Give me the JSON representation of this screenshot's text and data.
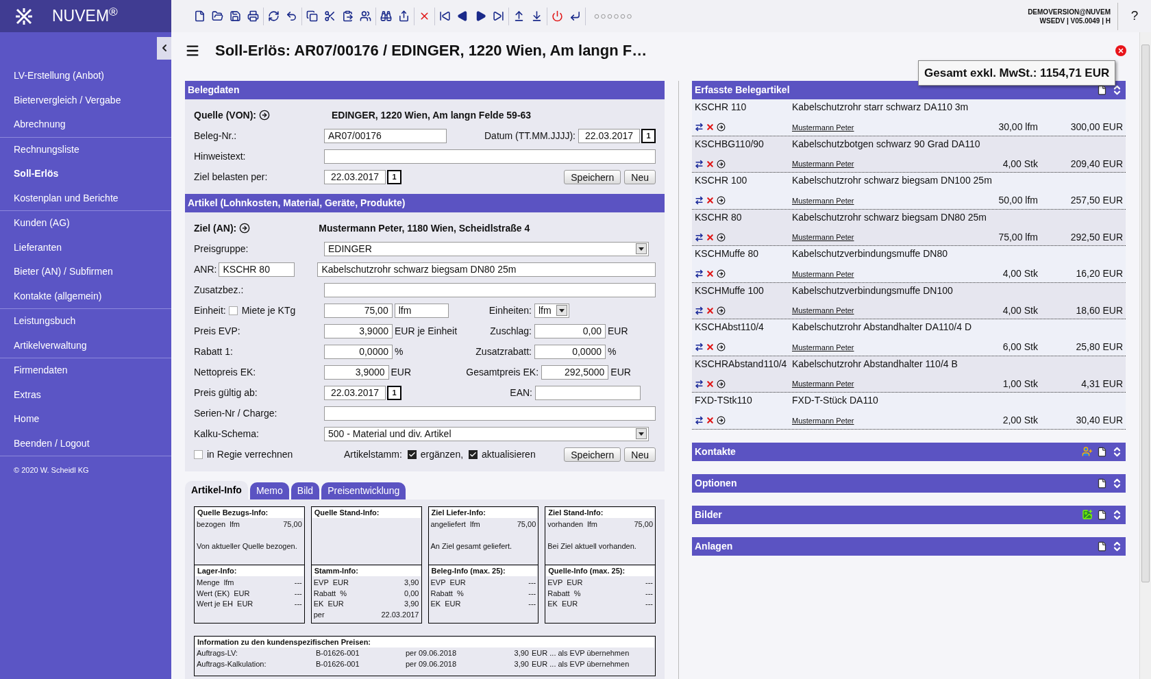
{
  "topbar": {
    "logo": "NUVEM$^{®}$",
    "user": "DEMOVERSION@NUVEM",
    "version": "WSEDV | V05.0049 | H",
    "help": "?"
  },
  "sidebar": {
    "groups": [
      [
        {
          "label": "LV-Erstellung (Anbot)",
          "selected": false
        },
        {
          "label": "Bietervergleich / Vergabe",
          "selected": false
        },
        {
          "label": "Abrechnung",
          "selected": false
        }
      ],
      [
        {
          "label": "Rechnungsliste",
          "selected": false
        },
        {
          "label": "Soll-Erlös",
          "selected": true
        },
        {
          "label": "Kostenplan und Berichte",
          "selected": false
        }
      ],
      [
        {
          "label": "Kunden (AG)",
          "selected": false
        },
        {
          "label": "Lieferanten",
          "selected": false
        },
        {
          "label": "Bieter (AN) / Subfirmen",
          "selected": false
        },
        {
          "label": "Kontakte (allgemein)",
          "selected": false
        }
      ],
      [
        {
          "label": "Leistungsbuch",
          "selected": false
        },
        {
          "label": "Artikelverwaltung",
          "selected": false
        }
      ],
      [
        {
          "label": "Firmendaten",
          "selected": false
        },
        {
          "label": "Extras",
          "selected": false
        },
        {
          "label": "Home",
          "selected": false
        },
        {
          "label": "Beenden / Logout",
          "selected": false
        }
      ]
    ],
    "copyright": "© 2020 W. Scheidl KG"
  },
  "title": "Soll-Erlös: AR07/00176 / EDINGER, 1220 Wien, Am langn F…",
  "total": "Gesamt exkl. MwSt.: 1154,71 EUR",
  "belegdaten": {
    "heading": "Belegdaten",
    "source_label": "Quelle (VON):",
    "source_value": "EDINGER, 1220 Wien, Am langn Felde 59-63",
    "number_label": "Beleg-Nr.:",
    "number_value": "AR07/00176",
    "date_label": "Datum (TT.MM.JJJJ):",
    "date": {
      "value": "22.03.2017",
      "calendar": "1"
    },
    "note_label": "Hinweistext:",
    "charge_label": "Ziel belasten per:",
    "charge_date": {
      "value": "22.03.2017",
      "calendar": "1"
    },
    "buttons": [
      "Speichern",
      "Neu"
    ]
  },
  "artikel": {
    "heading": "Artikel (Lohnkosten, Material, Geräte, Produkte)",
    "target_label": "Ziel (AN):",
    "target_value": "Mustermann Peter, 1180 Wien, Scheidlstraße 4",
    "price_group_label": "Preisgruppe:",
    "price_group": "EDINGER",
    "anr_label": "ANR:",
    "anr": "KSCHR 80",
    "description": "Kabelschutzrohr schwarz biegsam DN80 25m",
    "extra_label": "Zusatzbez.:",
    "unit_label": "Einheit:",
    "rent": {
      "label": "Miete je KTg",
      "checked": false
    },
    "quantity": "75,00",
    "unit": "lfm",
    "units_label": "Einheiten:",
    "units_select": "lfm",
    "pairs": [
      {
        "label": "Preis EVP:",
        "value": "3,9000",
        "unit": "EUR je Einheit",
        "right_label": "Zuschlag:",
        "right_value": "0,00",
        "right_unit": "EUR"
      },
      {
        "label": "Rabatt 1:",
        "value": "0,0000",
        "unit": "%",
        "right_label": "Zusatzrabatt:",
        "right_value": "0,0000",
        "right_unit": "%"
      },
      {
        "label": "Nettopreis EK:",
        "value": "3,9000",
        "unit": "EUR",
        "right_label": "Gesamtpreis EK:",
        "right_value": "292,5000",
        "right_unit": "EUR"
      }
    ],
    "valid_label": "Preis gültig ab:",
    "valid_date": {
      "value": "22.03.2017",
      "calendar": "1"
    },
    "ean_label": "EAN:",
    "serial_label": "Serien-Nr / Charge:",
    "schema_label": "Kalku-Schema:",
    "schema": "500 - Material und div. Artikel",
    "regie": {
      "label": "in Regie verrechnen",
      "checked": false
    },
    "master_label": "Artikelstamm:",
    "master_options": [
      {
        "label": "ergänzen,",
        "checked": true
      },
      {
        "label": "aktualisieren",
        "checked": true
      }
    ],
    "buttons": [
      "Speichern",
      "Neu"
    ]
  },
  "tabs": [
    {
      "label": "Artikel-Info",
      "selected": true
    },
    {
      "label": "Memo",
      "selected": false
    },
    {
      "label": "Bild",
      "selected": false
    },
    {
      "label": "Preisentwicklung",
      "selected": false
    }
  ],
  "info_boxes": [
    {
      "title": "Quelle Bezugs-Info:",
      "rows": [
        {
          "label": "bezogen  lfm",
          "value": "75,00"
        }
      ],
      "note": "Von aktueller Quelle bezogen."
    },
    {
      "title": "Quelle Stand-Info:"
    },
    {
      "title": "Ziel Liefer-Info:",
      "rows": [
        {
          "label": "angeliefert  lfm",
          "value": "75,00"
        }
      ],
      "note": "An Ziel gesamt geliefert."
    },
    {
      "title": "Ziel Stand-Info:",
      "rows": [
        {
          "label": "vorhanden  lfm",
          "value": "75,00"
        }
      ],
      "note": "Bei Ziel aktuell vorhanden."
    },
    {
      "title": "Lager-Info:",
      "rows": [
        {
          "label": "Menge  lfm",
          "value": "---"
        },
        {
          "label": "Wert (EK)  EUR",
          "value": "---"
        },
        {
          "label": "Wert je EH  EUR",
          "value": "---"
        }
      ]
    },
    {
      "title": "Stamm-Info:",
      "rows": [
        {
          "label": "EVP  EUR",
          "value": "3,90"
        },
        {
          "label": "Rabatt  %",
          "value": "0,00"
        },
        {
          "label": "EK  EUR",
          "value": "3,90"
        },
        {
          "label": "per",
          "value": "22.03.2017"
        }
      ]
    },
    {
      "title": "Beleg-Info (max. 25):",
      "rows": [
        {
          "label": "EVP  EUR",
          "value": "---"
        },
        {
          "label": "Rabatt  %",
          "value": "---"
        },
        {
          "label": "EK  EUR",
          "value": "---"
        }
      ]
    },
    {
      "title": "Quelle-Info (max. 25):",
      "rows": [
        {
          "label": "EVP  EUR",
          "value": "---"
        },
        {
          "label": "Rabatt  %",
          "value": "---"
        },
        {
          "label": "EK  EUR",
          "value": "---"
        }
      ]
    }
  ],
  "price_info": {
    "title": "Information zu den kundenspezifischen Preisen:",
    "rows": [
      {
        "label": "Auftrags-LV:",
        "code": "B-01626-001",
        "date": "per 09.06.2018",
        "price": "3,90",
        "action": "EUR ... als EVP übernehmen"
      },
      {
        "label": "Auftrags-Kalkulation:",
        "code": "B-01626-001",
        "date": "per 09.06.2018",
        "price": "3,90",
        "action": "EUR ... als EVP übernehmen"
      }
    ]
  },
  "articles": {
    "heading": "Erfasste Belegartikel",
    "rows": [
      {
        "code": "KSCHR 110",
        "description": "Kabelschutzrohr starr schwarz DA110 3m",
        "person": "Mustermann Peter",
        "quantity": "30,00 lfm",
        "price": "300,00 EUR"
      },
      {
        "code": "KSCHBG110/90",
        "description": "Kabelschutzbotgen schwarz 90 Grad DA110",
        "person": "Mustermann Peter",
        "quantity": "4,00 Stk",
        "price": "209,40 EUR"
      },
      {
        "code": "KSCHR 100",
        "description": "Kabelschutzrohr schwarz biegsam DN100 25m",
        "person": "Mustermann Peter",
        "quantity": "50,00 lfm",
        "price": "257,50 EUR"
      },
      {
        "code": "KSCHR 80",
        "description": "Kabelschutzrohr schwarz biegsam DN80 25m",
        "person": "Mustermann Peter",
        "quantity": "75,00 lfm",
        "price": "292,50 EUR"
      },
      {
        "code": "KSCHMuffe 80",
        "description": "Kabelschutzverbindungsmuffe DN80",
        "person": "Mustermann Peter",
        "quantity": "4,00 Stk",
        "price": "16,20 EUR"
      },
      {
        "code": "KSCHMuffe 100",
        "description": "Kabelschutzverbindungsmuffe DN100",
        "person": "Mustermann Peter",
        "quantity": "4,00 Stk",
        "price": "18,60 EUR"
      },
      {
        "code": "KSCHAbst110/4",
        "description": "Kabelschutzrohr Abstandhalter DA110/4 D",
        "person": "Mustermann Peter",
        "quantity": "6,00 Stk",
        "price": "25,80 EUR"
      },
      {
        "code": "KSCHRAbstand110/4",
        "description": "Kabelschutzrohr Abstandhalter 110/4 B",
        "person": "Mustermann Peter",
        "quantity": "1,00 Stk",
        "price": "4,31 EUR"
      },
      {
        "code": "FXD-TStk110",
        "description": "FXD-T-Stück DA110",
        "person": "Mustermann Peter",
        "quantity": "2,00 Stk",
        "price": "30,40 EUR"
      }
    ]
  },
  "sections": [
    {
      "title": "Kontakte",
      "kind": "contacts"
    },
    {
      "title": "Optionen",
      "kind": "plain"
    },
    {
      "title": "Bilder",
      "kind": "images"
    },
    {
      "title": "Anlagen",
      "kind": "plain"
    }
  ]
}
